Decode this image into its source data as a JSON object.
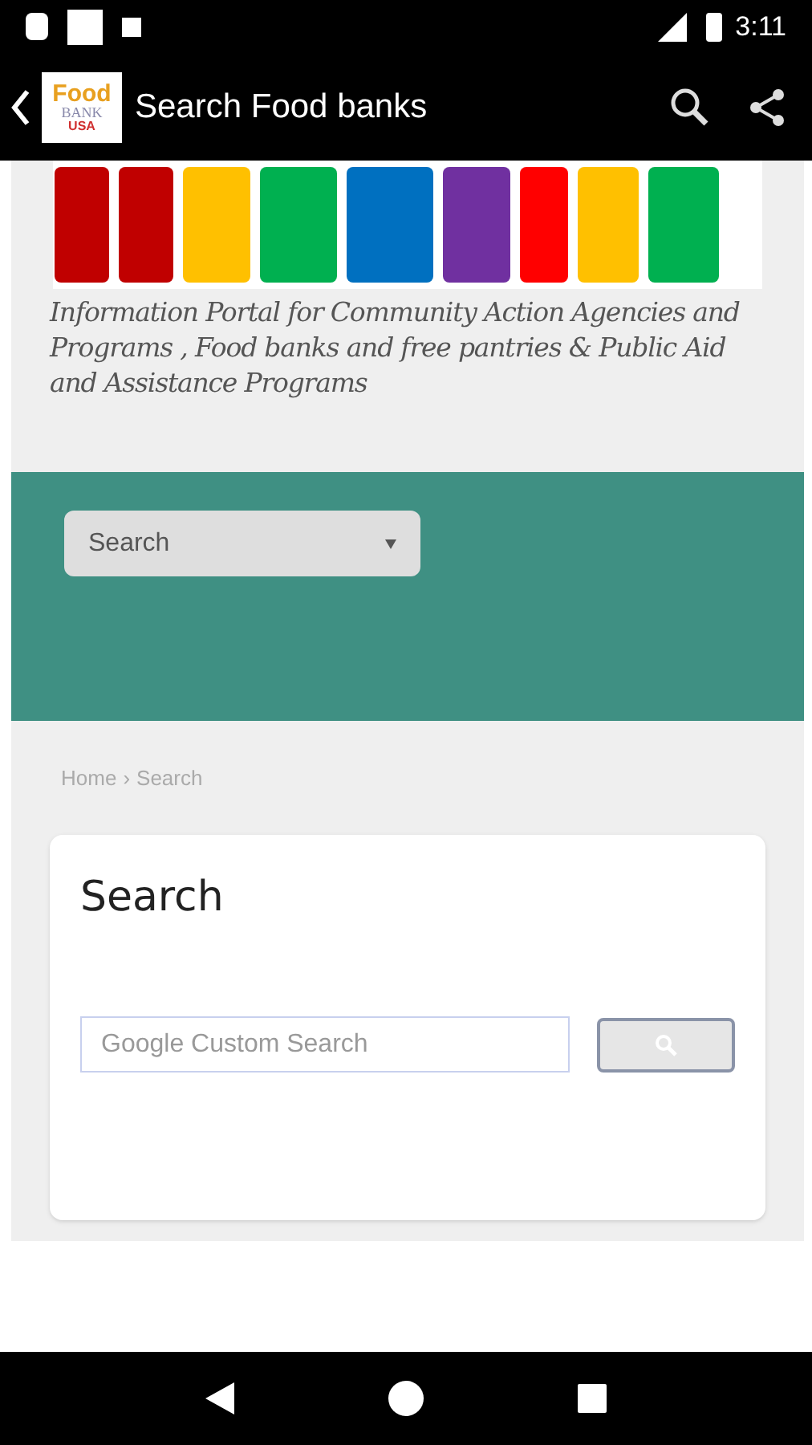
{
  "status_bar": {
    "time": "3:11"
  },
  "app_bar": {
    "logo": {
      "line_1": "Food",
      "line_2": "BANK",
      "line_3": "USA"
    },
    "title": "Search Food banks"
  },
  "header": {
    "tagline": "Information Portal for Community Action Agencies and Programs , Food banks and free pantries & Public Aid and Assistance Programs"
  },
  "nav_select": {
    "value": "Search"
  },
  "breadcrumb": [
    {
      "label": "Home",
      "separator": "›"
    },
    {
      "label": "Search"
    }
  ],
  "search_card": {
    "heading": "Search",
    "field": {
      "placeholder": "Google Custom Search"
    }
  }
}
